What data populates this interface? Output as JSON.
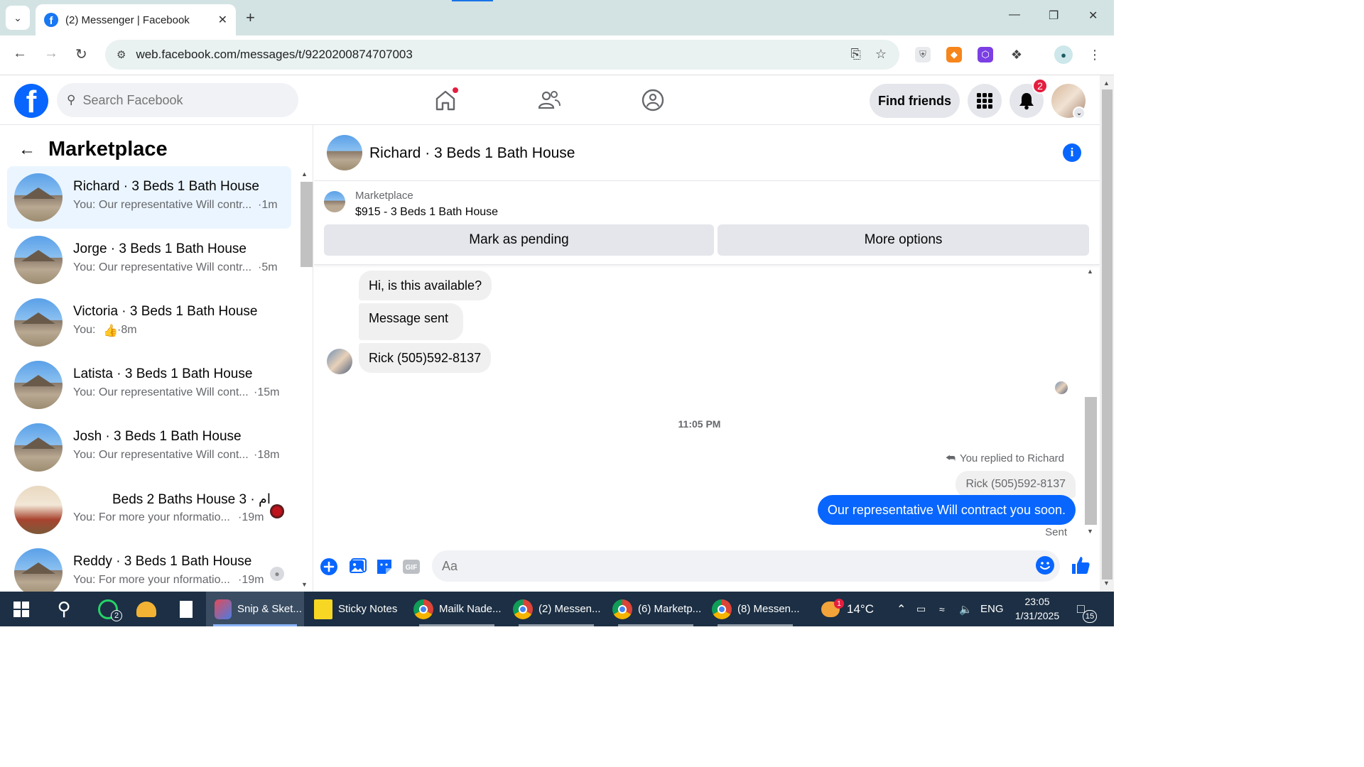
{
  "browser": {
    "tab_title": "(2) Messenger | Facebook",
    "url": "web.facebook.com/messages/t/9220200874707003"
  },
  "fb": {
    "search_placeholder": "Search Facebook",
    "find_friends": "Find friends",
    "notification_count": "2"
  },
  "left": {
    "title": "Marketplace",
    "conversations": [
      {
        "name": "Richard · 3 Beds 1 Bath House",
        "preview": "You: Our representative Will contr...",
        "time": "·1m"
      },
      {
        "name": "Jorge · 3 Beds 1 Bath House",
        "preview": "You: Our representative Will contr...",
        "time": "·5m"
      },
      {
        "name": "Victoria · 3 Beds 1 Bath House",
        "preview": "You:",
        "time": "·8m"
      },
      {
        "name": "Latista · 3 Beds 1 Bath House",
        "preview": "You: Our representative Will cont...",
        "time": "·15m"
      },
      {
        "name": "Josh · 3 Beds 1 Bath House",
        "preview": "You: Our representative Will cont...",
        "time": "·18m"
      },
      {
        "name": "Beds 2 Baths House 3 · ام",
        "preview": "You: For more your nformatio...",
        "time": "·19m"
      },
      {
        "name": "Reddy · 3 Beds 1 Bath House",
        "preview": "You: For more your nformatio...",
        "time": "·19m"
      }
    ]
  },
  "chat": {
    "title": "Richard · 3 Beds 1 Bath House",
    "marketplace_label": "Marketplace",
    "listing": "$915 - 3 Beds 1 Bath House",
    "mark_pending": "Mark as pending",
    "more_options": "More options",
    "messages_in": [
      "Hi, is this available?",
      "Message sent",
      "Rick (505)592-8137"
    ],
    "time_separator": "11:05 PM",
    "replied_to": "You replied to Richard",
    "quoted": "Rick (505)592-8137",
    "outgoing": "Our representative Will contract you soon.",
    "status": "Sent",
    "composer_placeholder": "Aa"
  },
  "taskbar": {
    "items": [
      "Snip & Sket...",
      "Sticky Notes",
      "Mailk Nade...",
      "(2) Messen...",
      "(6) Marketp...",
      "(8) Messen..."
    ],
    "whatsapp_count": "2",
    "weather": "14°C",
    "weather_badge": "1",
    "lang": "ENG",
    "time": "23:05",
    "date": "1/31/2025",
    "notif_count": "15"
  },
  "colors": {
    "fb_blue": "#0866ff",
    "active_row": "#ebf5ff",
    "badge_red": "#e41e3f"
  }
}
